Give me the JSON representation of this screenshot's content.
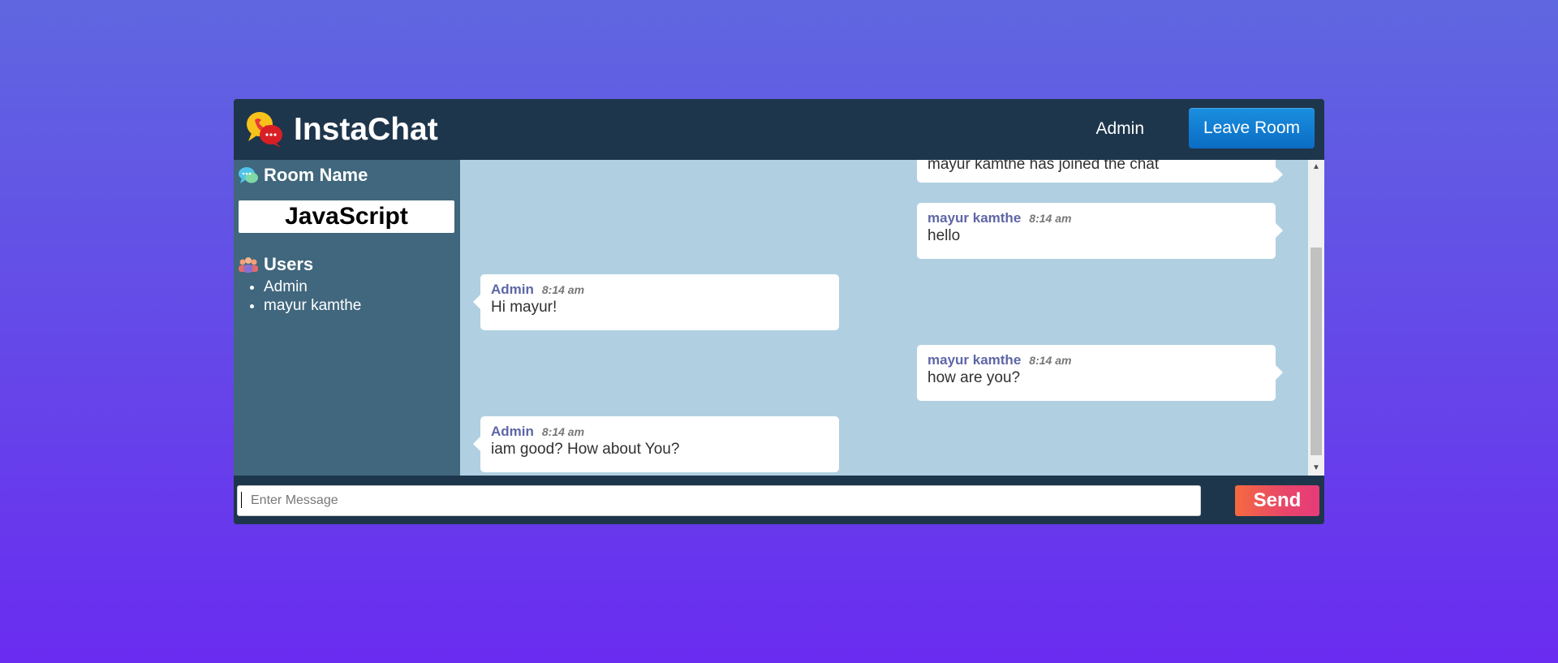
{
  "header": {
    "app_title": "InstaChat",
    "logo_icon": "chat-bubbles-logo-icon",
    "current_user": "Admin",
    "leave_label": "Leave Room"
  },
  "sidebar": {
    "room_heading": "Room Name",
    "room_icon": "chat-bubbles-icon",
    "room_name": "JavaScript",
    "users_heading": "Users",
    "users_icon": "users-group-icon",
    "users": [
      "Admin",
      "mayur kamthe"
    ]
  },
  "messages": [
    {
      "side": "right",
      "user": "",
      "time": "",
      "text": "mayur kamthe has joined the chat"
    },
    {
      "side": "right",
      "user": "mayur kamthe",
      "time": "8:14 am",
      "text": "hello"
    },
    {
      "side": "left",
      "user": "Admin",
      "time": "8:14 am",
      "text": "Hi mayur!"
    },
    {
      "side": "right",
      "user": "mayur kamthe",
      "time": "8:14 am",
      "text": "how are you?"
    },
    {
      "side": "left",
      "user": "Admin",
      "time": "8:14 am",
      "text": "iam good? How about You?"
    }
  ],
  "composer": {
    "placeholder": "Enter Message",
    "value": "",
    "send_label": "Send"
  },
  "colors": {
    "header_bg": "#1e364c",
    "sidebar_bg": "#40677d",
    "messages_bg": "#b0d0e2",
    "username": "#5e66a6",
    "leave_button": "#1a8fe0",
    "send_gradient_start": "#f56a3f",
    "send_gradient_end": "#e63b7a"
  }
}
